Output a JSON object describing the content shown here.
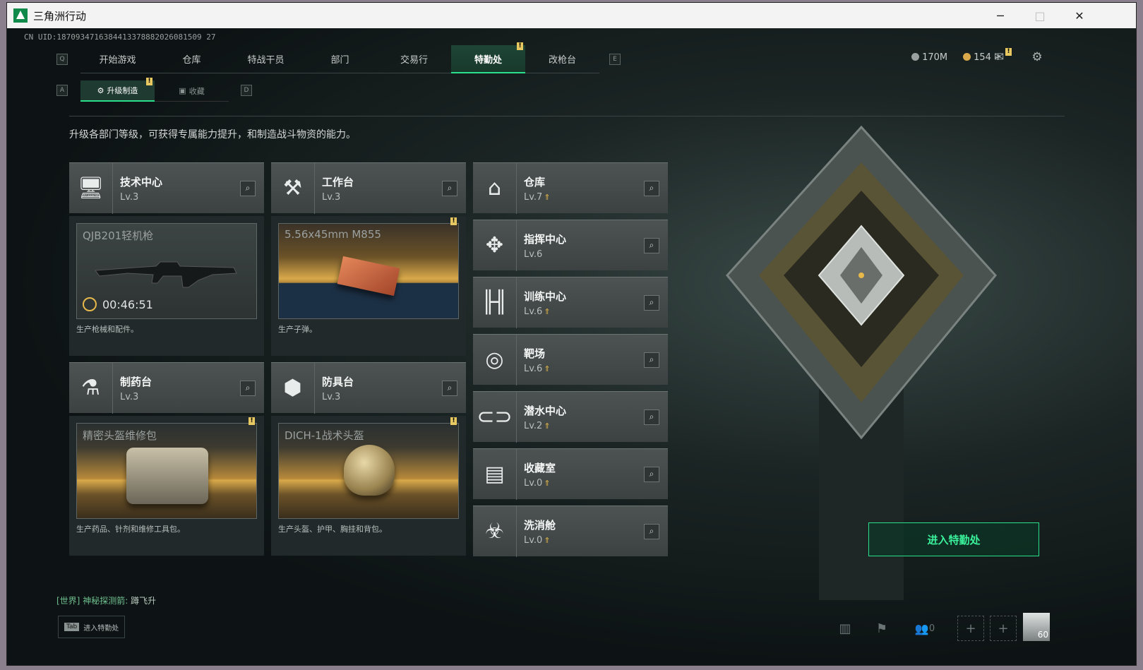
{
  "window": {
    "title": "三角洲行动",
    "minimize": "─",
    "maximize": "□",
    "close": "✕"
  },
  "uid": "CN UID:1870934716384413378882026081509 27",
  "nav": {
    "left_key": "Q",
    "right_key": "E",
    "tabs": [
      {
        "label": "开始游戏"
      },
      {
        "label": "仓库"
      },
      {
        "label": "特战干员"
      },
      {
        "label": "部门"
      },
      {
        "label": "交易行"
      },
      {
        "label": "特勤处",
        "active": true
      },
      {
        "label": "改枪台"
      }
    ]
  },
  "subnav": {
    "left_key": "A",
    "right_key": "D",
    "tabs": [
      {
        "label": "升级制造",
        "active": true
      },
      {
        "label": "收藏"
      }
    ]
  },
  "header": {
    "money": "170M",
    "coins": "154",
    "plus": "+"
  },
  "description": "升级各部门等级，可获得专属能力提升，和制造战斗物资的能力。",
  "workbenches": [
    {
      "name": "技术中心",
      "level": "Lv.3",
      "product": "QJB201轻机枪",
      "timer": "00:46:51",
      "desc": "生产枪械和配件。"
    },
    {
      "name": "工作台",
      "level": "Lv.3",
      "product": "5.56x45mm M855",
      "desc": "生产子弹。"
    },
    {
      "name": "制药台",
      "level": "Lv.3",
      "product": "精密头盔维修包",
      "desc": "生产药品、针剂和维修工具包。"
    },
    {
      "name": "防具台",
      "level": "Lv.3",
      "product": "DICH-1战术头盔",
      "desc": "生产头盔、护甲、胸挂和背包。"
    }
  ],
  "facilities": [
    {
      "name": "仓库",
      "level": "Lv.7",
      "upgrade": true
    },
    {
      "name": "指挥中心",
      "level": "Lv.6",
      "upgrade": false
    },
    {
      "name": "训练中心",
      "level": "Lv.6",
      "upgrade": true
    },
    {
      "name": "靶场",
      "level": "Lv.6",
      "upgrade": true
    },
    {
      "name": "潜水中心",
      "level": "Lv.2",
      "upgrade": true
    },
    {
      "name": "收藏室",
      "level": "Lv.0",
      "upgrade": true
    },
    {
      "name": "洗消舱",
      "level": "Lv.0",
      "upgrade": true
    }
  ],
  "enter_button": "进入特勤处",
  "chat": {
    "channel": "[世界]",
    "user": "神秘探测箭:",
    "message": "蹲飞升"
  },
  "tab_hint": {
    "key": "Tab",
    "label": "进入特勤处"
  },
  "bottom": {
    "friends_count": "0",
    "avatar_level": "60"
  },
  "colors": {
    "accent": "#2be08a",
    "upgrade": "#e6b94a",
    "badge": "#e8c860"
  }
}
